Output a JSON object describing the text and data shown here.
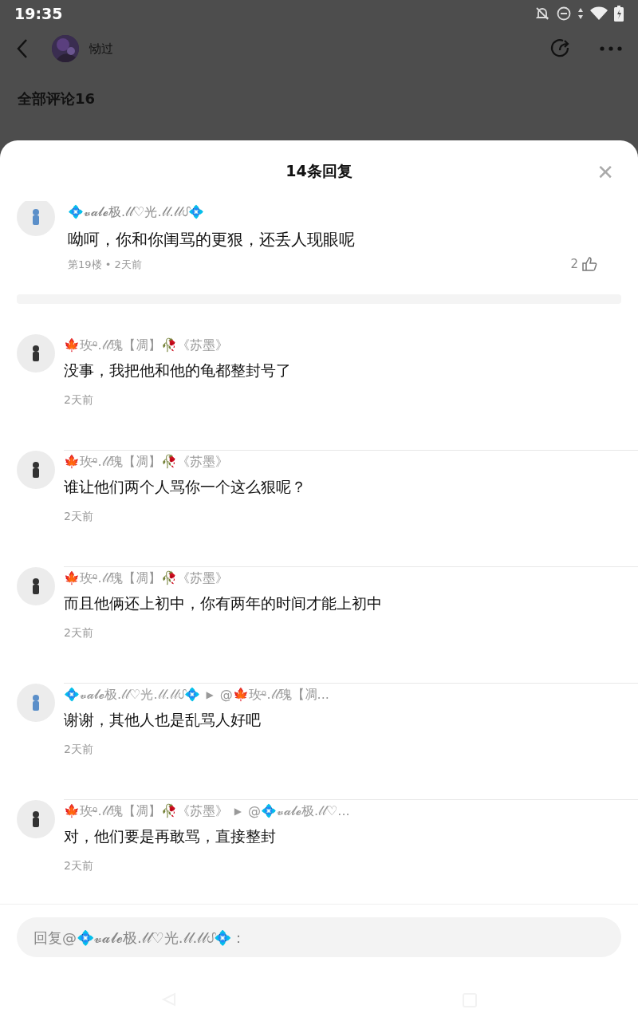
{
  "status_bar": {
    "time": "19:35"
  },
  "header": {
    "author": "恸过"
  },
  "behind": {
    "comments_title": "全部评论16"
  },
  "sheet": {
    "title": "14条回复",
    "close": "✕"
  },
  "main_comment": {
    "name": "💠𝓿𝓪𝓵𝓮极.𝓁𝓁♡光.𝓁𝓁.𝓁𝓁ᦔ💠",
    "text": "呦呵，你和你闺骂的更狠，还丢人现眼呢",
    "meta": "第19楼 • 2天前",
    "likes": "2",
    "color": "#5b8fc9"
  },
  "replies": [
    {
      "name": "🍁玫ᵒ̴.𝓁𝓁瑰【凋】🥀《苏墨》",
      "text": "没事，我把他和他的龟都整封号了",
      "time": "2天前",
      "color": "#333333"
    },
    {
      "name": "🍁玫ᵒ̴.𝓁𝓁瑰【凋】🥀《苏墨》",
      "text": "谁让他们两个人骂你一个这么狠呢？",
      "time": "2天前",
      "color": "#333333"
    },
    {
      "name": "🍁玫ᵒ̴.𝓁𝓁瑰【凋】🥀《苏墨》",
      "text": "而且他俩还上初中，你有两年的时间才能上初中",
      "time": "2天前",
      "color": "#333333"
    },
    {
      "name": "💠𝓿𝓪𝓵𝓮极.𝓁𝓁♡光.𝓁𝓁.𝓁𝓁ᦔ💠",
      "arrow": "▶",
      "reply_to": "@🍁玫ᵒ̴.𝓁𝓁瑰【凋...",
      "text": "谢谢，其他人也是乱骂人好吧",
      "time": "2天前",
      "color": "#5b8fc9"
    },
    {
      "name": "🍁玫ᵒ̴.𝓁𝓁瑰【凋】🥀《苏墨》",
      "arrow": "▶",
      "reply_to": "@💠𝓿𝓪𝓵𝓮极.𝓁𝓁♡...",
      "text": "对，他们要是再敢骂，直接整封",
      "time": "2天前",
      "color": "#333333"
    }
  ],
  "reply_input": {
    "placeholder": "回复@💠𝓿𝓪𝓵𝓮极.𝓁𝓁♡光.𝓁𝓁.𝓁𝓁ᦔ💠："
  }
}
